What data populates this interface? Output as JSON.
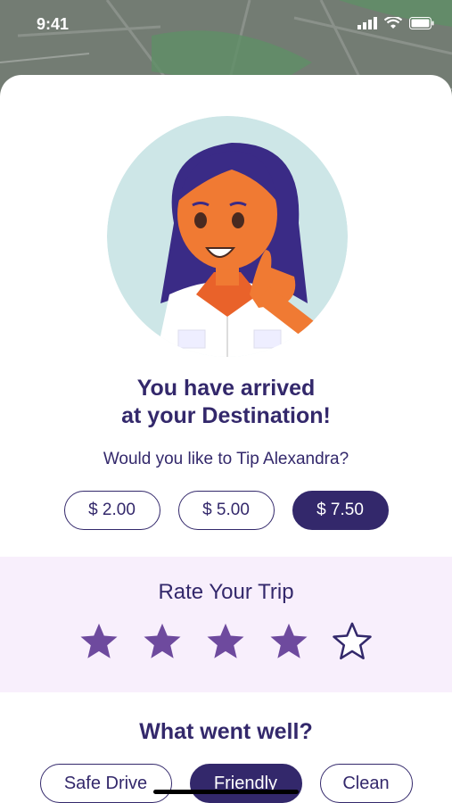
{
  "status_bar": {
    "time": "9:41"
  },
  "title_line1": "You have arrived",
  "title_line2": "at your Destination!",
  "tip_prompt": "Would you like to Tip Alexandra?",
  "tips": [
    {
      "label": "$ 2.00",
      "selected": false
    },
    {
      "label": "$ 5.00",
      "selected": false
    },
    {
      "label": "$ 7.50",
      "selected": true
    }
  ],
  "rating": {
    "title": "Rate Your Trip",
    "value": 4,
    "max": 5
  },
  "feedback": {
    "title": "What went well?",
    "chips": [
      {
        "label": "Safe Drive",
        "selected": false
      },
      {
        "label": "Friendly",
        "selected": true
      },
      {
        "label": "Clean",
        "selected": false
      }
    ]
  },
  "colors": {
    "primary": "#33286b",
    "star": "#6e4a9e",
    "rate_bg": "#f8effc",
    "avatar_bg": "#cde6e7"
  },
  "icons": [
    "signal-icon",
    "wifi-icon",
    "battery-icon",
    "star-icon"
  ]
}
